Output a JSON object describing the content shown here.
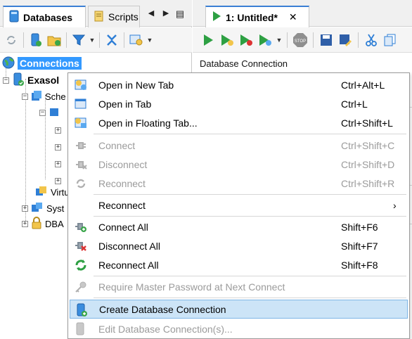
{
  "left": {
    "tabs": [
      {
        "label": "Databases",
        "icon": "database-icon"
      },
      {
        "label": "Scripts",
        "icon": "scripts-icon"
      }
    ],
    "tree": {
      "root": "Connections",
      "connection": "Exasol",
      "schemas": "Sche",
      "virtual": "Virtu",
      "system": "Syst",
      "dba": "DBA"
    }
  },
  "right": {
    "tab": {
      "label": "1: Untitled*",
      "close": "✕"
    },
    "subtitle": "Database Connection",
    "stop_label": "STOP"
  },
  "menu": {
    "items": [
      {
        "label": "Open in New Tab",
        "shortcut": "Ctrl+Alt+L",
        "icon": "open-new-tab-icon",
        "disabled": false
      },
      {
        "label": "Open in Tab",
        "shortcut": "Ctrl+L",
        "icon": "open-tab-icon",
        "disabled": false
      },
      {
        "label": "Open in Floating Tab...",
        "shortcut": "Ctrl+Shift+L",
        "icon": "floating-tab-icon",
        "disabled": false
      },
      {
        "label": "Connect",
        "shortcut": "Ctrl+Shift+C",
        "icon": "connect-plug-icon",
        "disabled": true
      },
      {
        "label": "Disconnect",
        "shortcut": "Ctrl+Shift+D",
        "icon": "disconnect-plug-icon",
        "disabled": true
      },
      {
        "label": "Reconnect",
        "shortcut": "Ctrl+Shift+R",
        "icon": "reconnect-icon",
        "disabled": true
      },
      {
        "label": "Reconnect",
        "shortcut": "",
        "arrow": "›",
        "disabled": false
      },
      {
        "label": "Connect All",
        "shortcut": "Shift+F6",
        "icon": "connect-all-icon",
        "disabled": false
      },
      {
        "label": "Disconnect All",
        "shortcut": "Shift+F7",
        "icon": "disconnect-all-icon",
        "disabled": false
      },
      {
        "label": "Reconnect All",
        "shortcut": "Shift+F8",
        "icon": "reconnect-all-icon",
        "disabled": false
      },
      {
        "label": "Require Master Password at Next Connect",
        "shortcut": "",
        "icon": "key-icon",
        "disabled": true
      },
      {
        "label": "Create Database Connection",
        "shortcut": "",
        "icon": "create-connection-icon",
        "disabled": false,
        "highlighted": true
      },
      {
        "label": "Edit Database Connection(s)...",
        "shortcut": "",
        "icon": "edit-connection-icon",
        "disabled": true
      }
    ]
  },
  "colors": {
    "selection": "#3399ff",
    "menu_highlight": "#cce4f7",
    "disabled_text": "#9b9b9b",
    "run_green": "#2ea043"
  }
}
